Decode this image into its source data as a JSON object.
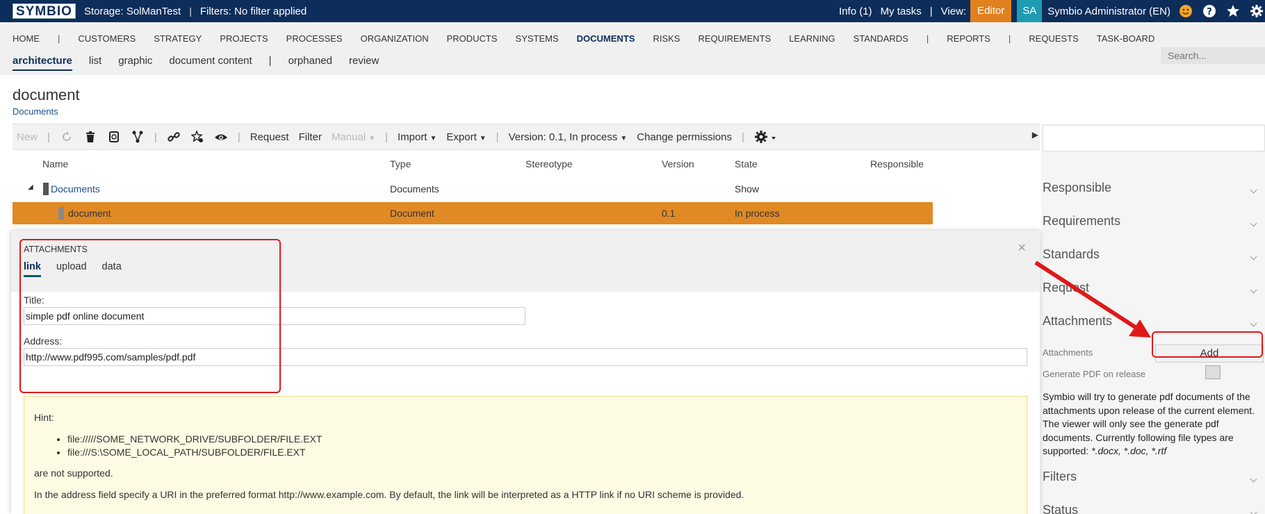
{
  "topbar": {
    "logo": "SYMBIO",
    "storage": "Storage:  SolManTest",
    "sep": "|",
    "filters": "Filters: No filter applied",
    "info": "Info (1)",
    "my_tasks": "My tasks",
    "view_label": "View:",
    "view_value": "Editor",
    "user_initials": "SA",
    "user_name": "Symbio Administrator (EN)",
    "icons": [
      "smiley-icon",
      "help-icon",
      "star-icon",
      "gear-icon"
    ]
  },
  "nav": {
    "main": [
      "HOME",
      "|",
      "CUSTOMERS",
      "STRATEGY",
      "PROJECTS",
      "PROCESSES",
      "ORGANIZATION",
      "PRODUCTS",
      "SYSTEMS",
      "DOCUMENTS",
      "RISKS",
      "REQUIREMENTS",
      "LEARNING",
      "STANDARDS",
      "|",
      "REPORTS",
      "|",
      "REQUESTS",
      "TASK-BOARD"
    ],
    "active_main": "DOCUMENTS",
    "sub": [
      "architecture",
      "list",
      "graphic",
      "document content",
      "|",
      "orphaned",
      "review"
    ],
    "search_placeholder": "Search..."
  },
  "page": {
    "title": "document",
    "breadcrumb": "Documents"
  },
  "toolbar": {
    "new": "New",
    "request": "Request",
    "filter": "Filter",
    "manual": "Manual",
    "import": "Import",
    "export": "Export",
    "version": "Version: 0.1, In process",
    "change_permissions": "Change permissions"
  },
  "table": {
    "columns": [
      "Name",
      "Type",
      "Stereotype",
      "Version",
      "State",
      "Responsible"
    ],
    "rows": [
      {
        "name": "Documents",
        "type": "Documents",
        "stereotype": "",
        "version": "",
        "state": "Show",
        "responsible": ""
      },
      {
        "name": "document",
        "type": "Document",
        "stereotype": "",
        "version": "0.1",
        "state": "In process",
        "responsible": ""
      }
    ]
  },
  "right_panel": {
    "sections": [
      "Responsible",
      "Requirements",
      "Standards",
      "Request",
      "Attachments",
      "Filters",
      "Status"
    ],
    "attachments_label": "Attachments",
    "add_button": "Add",
    "generate_pdf_label": "Generate PDF on release",
    "generate_pdf_checked": false,
    "note": "Symbio will try to generate pdf documents of the attachments upon release of the current element. The viewer will only see the generate pdf documents. Currently following file types are supported:",
    "note_types": "*.docx, *.doc, *.rtf"
  },
  "dialog": {
    "title": "ATTACHMENTS",
    "tabs": [
      "link",
      "upload",
      "data"
    ],
    "active_tab": "link",
    "close": "×",
    "title_label": "Title:",
    "title_value": "simple pdf online document",
    "address_label": "Address:",
    "address_value": "http://www.pdf995.com/samples/pdf.pdf",
    "hint": {
      "heading": "Hint:",
      "items": [
        "file://///SOME_NETWORK_DRIVE/SUBFOLDER/FILE.EXT",
        "file:///S:\\SOME_LOCAL_PATH/SUBFOLDER/FILE.EXT"
      ],
      "not_supported": "are not supported.",
      "detail": "In the address field specify a URI in the preferred format http://www.example.com. By default, the link will be interpreted as a HTTP link if no URI scheme is provided."
    }
  },
  "colors": {
    "topbar": "#0d2d5a",
    "editor": "#e0801e",
    "user": "#1f9bb3",
    "selected_row": "#e08a25",
    "annotation": "#e01818",
    "hint_bg": "#fdfbe3"
  }
}
